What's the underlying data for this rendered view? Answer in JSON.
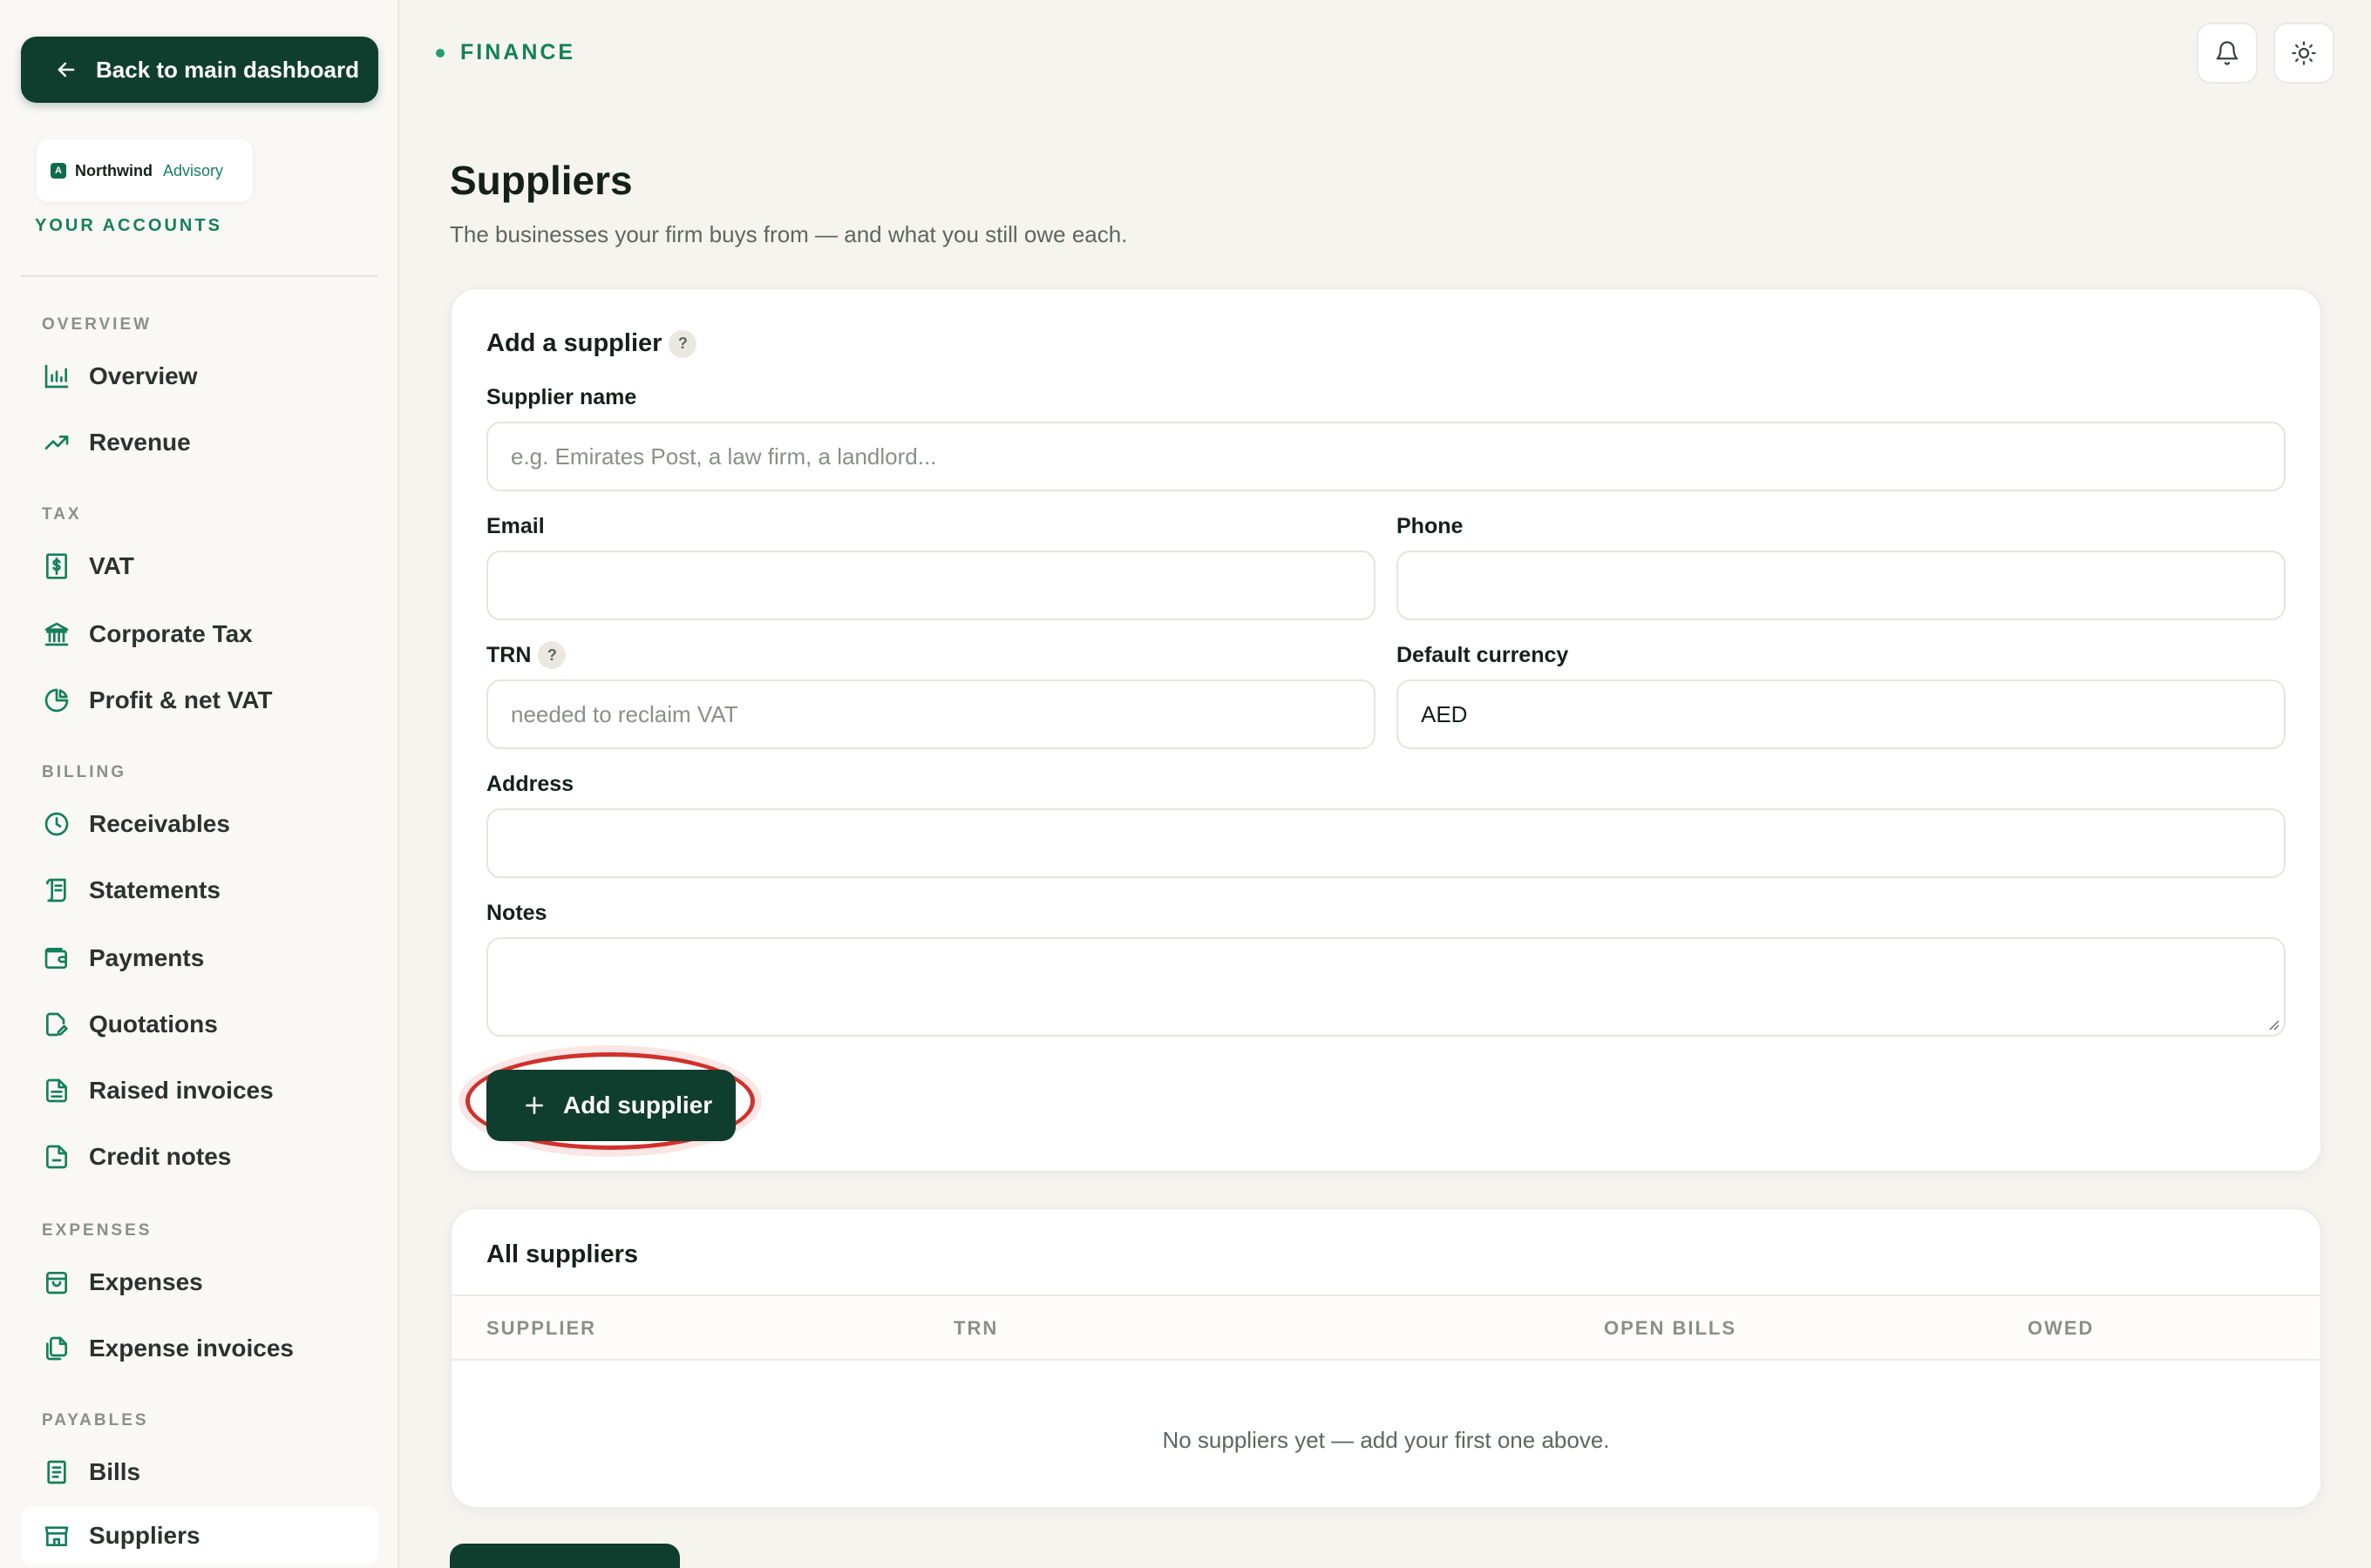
{
  "sidebar": {
    "back_label": "Back to main dashboard",
    "brand_name": "Northwind",
    "brand_sub": "Advisory",
    "brand_logo_letter": "A",
    "accounts_label": "YOUR ACCOUNTS",
    "sections": {
      "overview": "OVERVIEW",
      "tax": "TAX",
      "billing": "BILLING",
      "expenses": "EXPENSES",
      "payables": "PAYABLES"
    },
    "items": {
      "overview": "Overview",
      "revenue": "Revenue",
      "vat": "VAT",
      "corporate_tax": "Corporate Tax",
      "profit_net_vat": "Profit & net VAT",
      "receivables": "Receivables",
      "statements": "Statements",
      "payments": "Payments",
      "quotations": "Quotations",
      "raised_invoices": "Raised invoices",
      "credit_notes": "Credit notes",
      "expenses": "Expenses",
      "expense_invoices": "Expense invoices",
      "bills": "Bills",
      "suppliers": "Suppliers"
    }
  },
  "header": {
    "section": "FINANCE",
    "icons": [
      "bell-icon",
      "sun-icon"
    ]
  },
  "page": {
    "title": "Suppliers",
    "subtitle": "The businesses your firm buys from — and what you still owe each."
  },
  "form": {
    "title": "Add a supplier",
    "help": "?",
    "supplier_name_label": "Supplier name",
    "supplier_name_placeholder": "e.g. Emirates Post, a law firm, a landlord...",
    "email_label": "Email",
    "email_value": "",
    "phone_label": "Phone",
    "phone_value": "",
    "trn_label": "TRN",
    "trn_placeholder": "needed to reclaim VAT",
    "currency_label": "Default currency",
    "currency_value": "AED",
    "address_label": "Address",
    "address_value": "",
    "notes_label": "Notes",
    "notes_value": "",
    "submit_label": "Add supplier"
  },
  "table": {
    "title": "All suppliers",
    "columns": [
      "SUPPLIER",
      "TRN",
      "OPEN BILLS",
      "OWED"
    ],
    "empty_text": "No suppliers yet — add your first one above."
  },
  "colors": {
    "primary": "#0f3d2e",
    "accent": "#14805b",
    "highlight_ring": "#d0312d"
  }
}
